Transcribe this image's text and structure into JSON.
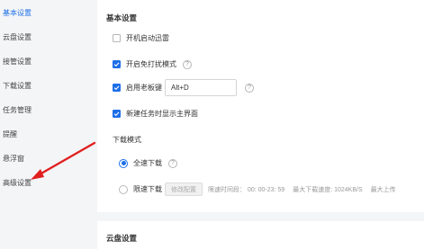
{
  "sidebar": {
    "items": [
      {
        "label": "基本设置",
        "active": true
      },
      {
        "label": "云盘设置",
        "active": false
      },
      {
        "label": "接管设置",
        "active": false
      },
      {
        "label": "下载设置",
        "active": false
      },
      {
        "label": "任务管理",
        "active": false
      },
      {
        "label": "提醒",
        "active": false
      },
      {
        "label": "悬浮窗",
        "active": false
      },
      {
        "label": "高级设置",
        "active": false
      }
    ]
  },
  "basic": {
    "title": "基本设置",
    "startup_label": "开机启动迅雷",
    "nodisturb_label": "开启免打扰模式",
    "bosskey_label": "启用老板键",
    "bosskey_value": "Alt+D",
    "show_main_label": "新建任务时显示主界面",
    "download_mode_title": "下载模式",
    "full_speed_label": "全速下载",
    "limit_speed_label": "限速下载",
    "modify_config_label": "修改配置",
    "limit_time_text": "限速时间段： 00: 00-23: 59",
    "max_download_text": "最大下载速度: 1024KB/S",
    "max_upload_text": "最大上传"
  },
  "cloud": {
    "title": "云盘设置"
  },
  "icons": {
    "help": "help-circle-icon",
    "check": "check-icon",
    "annotation_arrow": "red-arrow"
  },
  "colors": {
    "accent": "#1d6fe8",
    "annotation_arrow": "#e02020",
    "background": "#f4f5f7",
    "panel": "#ffffff"
  }
}
